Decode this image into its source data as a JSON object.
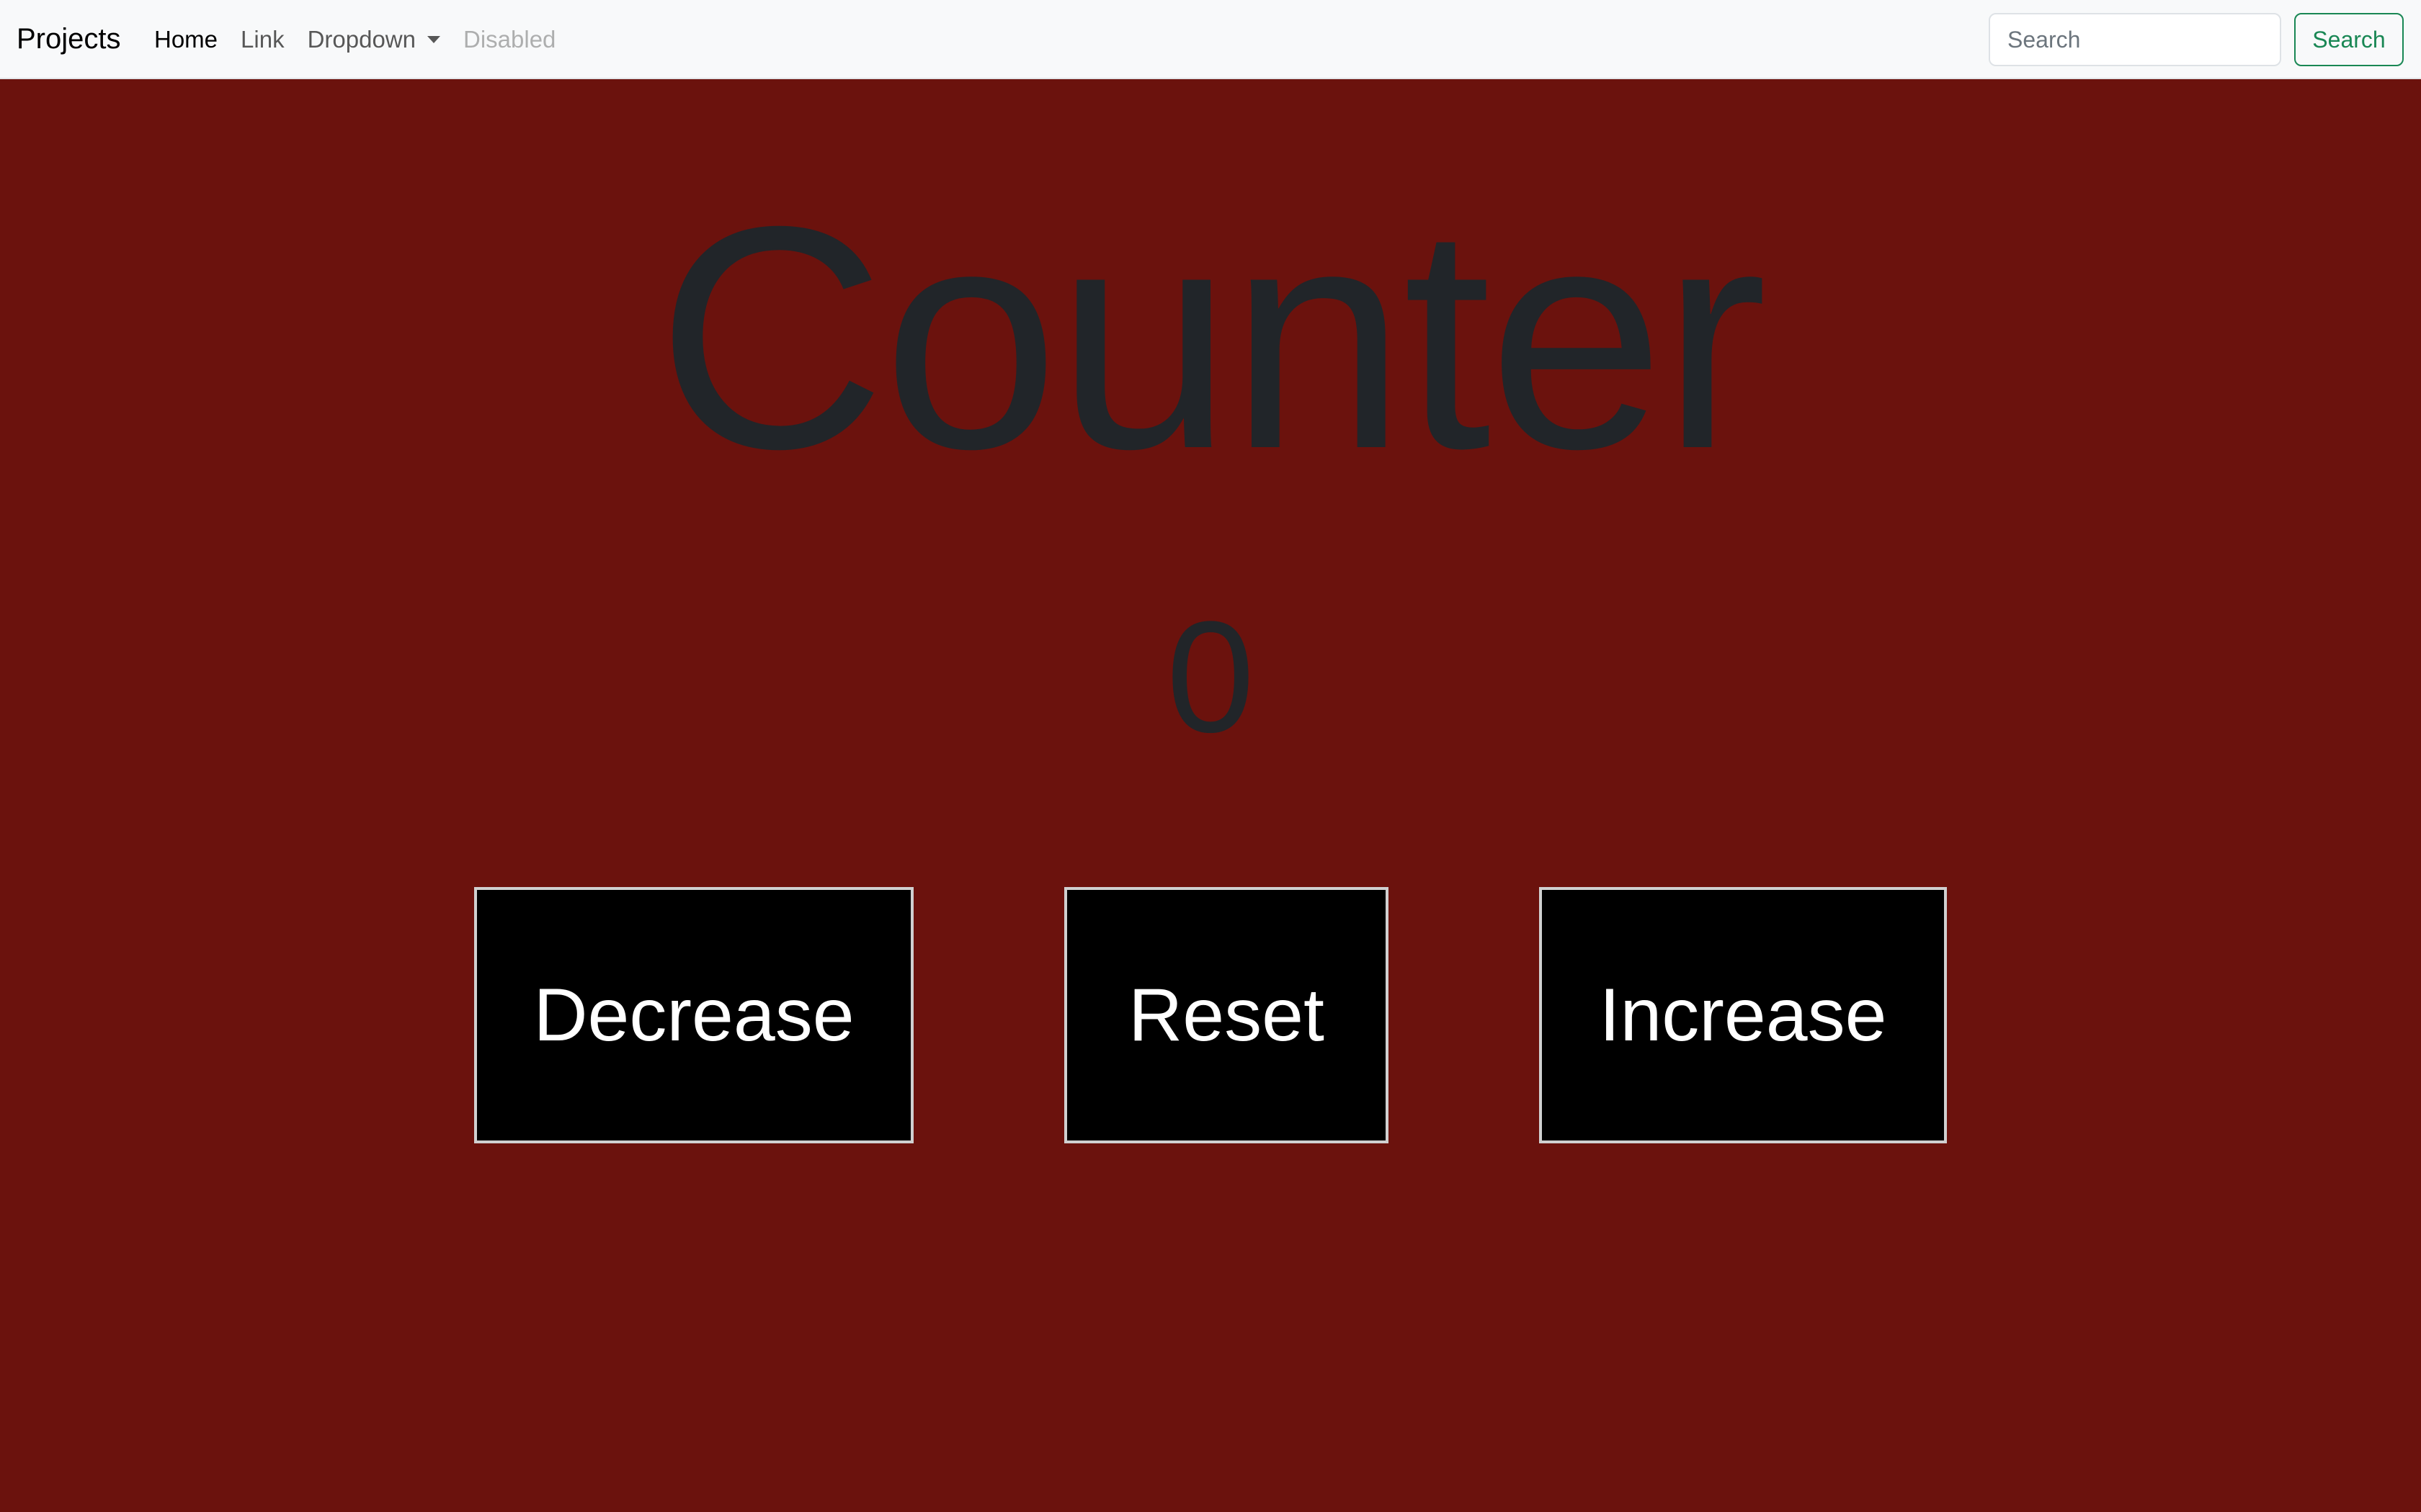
{
  "navbar": {
    "brand": "Projects",
    "links": [
      {
        "label": "Home",
        "state": "active"
      },
      {
        "label": "Link",
        "state": "normal"
      },
      {
        "label": "Dropdown",
        "state": "normal"
      },
      {
        "label": "Disabled",
        "state": "disabled"
      }
    ],
    "search": {
      "placeholder": "Search",
      "value": "",
      "button_label": "Search"
    }
  },
  "main": {
    "title": "Counter",
    "count": "0",
    "buttons": {
      "decrease": "Decrease",
      "reset": "Reset",
      "increase": "Increase"
    }
  },
  "colors": {
    "background": "#6b120d",
    "navbar_bg": "#f8f9fa",
    "text_dark": "#212529",
    "button_bg": "#000000",
    "button_text": "#ffffff",
    "search_accent": "#198754"
  }
}
